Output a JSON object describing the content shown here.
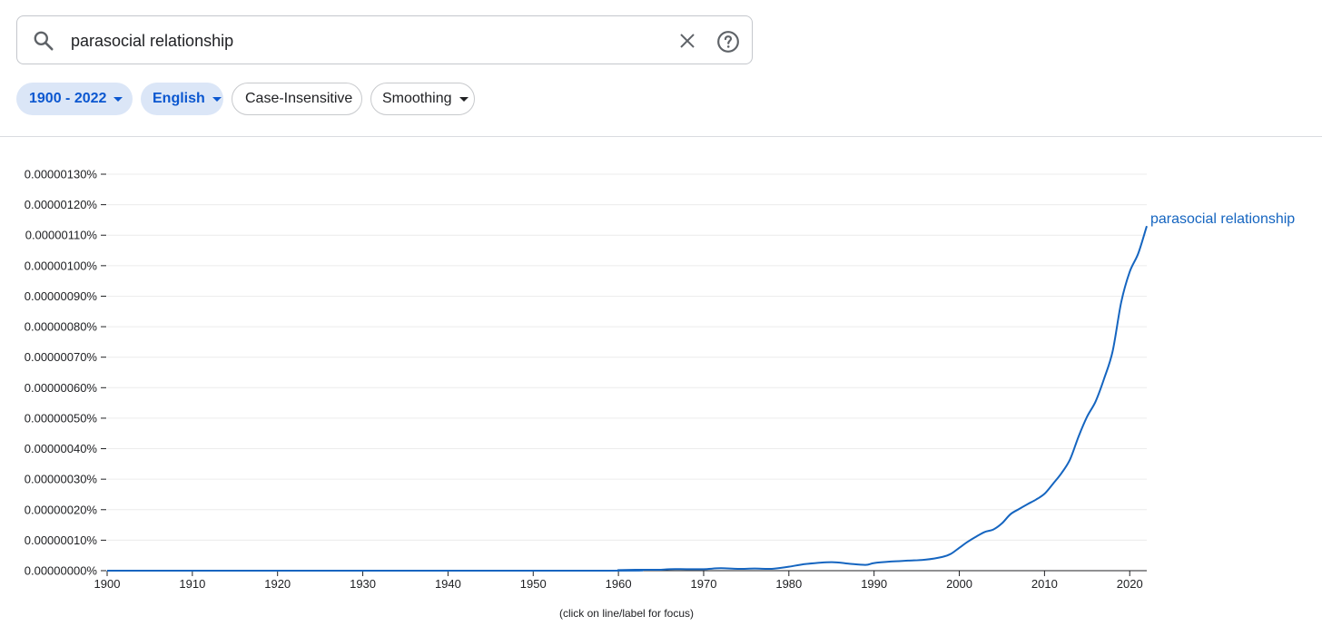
{
  "search": {
    "query": "parasocial relationship"
  },
  "filters": {
    "year_range": "1900 - 2022",
    "corpus": "English",
    "case": "Case-Insensitive",
    "smoothing": "Smoothing"
  },
  "chart_data": {
    "type": "line",
    "ylim": [
      0,
      1.3e-06
    ],
    "xlim": [
      1900,
      2022
    ],
    "y_ticks": [
      "0.00000000%",
      "0.00000010%",
      "0.00000020%",
      "0.00000030%",
      "0.00000040%",
      "0.00000050%",
      "0.00000060%",
      "0.00000070%",
      "0.00000080%",
      "0.00000090%",
      "0.00000100%",
      "0.00000110%",
      "0.00000120%",
      "0.00000130%"
    ],
    "x_ticks": [
      "1900",
      "1910",
      "1920",
      "1930",
      "1940",
      "1950",
      "1960",
      "1970",
      "1980",
      "1990",
      "2000",
      "2010",
      "2020"
    ],
    "grid": true,
    "series": [
      {
        "name": "parasocial relationship",
        "color": "#1565c0",
        "x": [
          1900,
          1958,
          1960,
          1962,
          1964,
          1965,
          1966,
          1968,
          1970,
          1972,
          1974,
          1976,
          1978,
          1980,
          1982,
          1985,
          1987,
          1989,
          1990,
          1992,
          1994,
          1996,
          1998,
          1999,
          2000,
          2001,
          2002,
          2003,
          2004,
          2005,
          2006,
          2007,
          2008,
          2009,
          2010,
          2011,
          2012,
          2013,
          2014,
          2015,
          2016,
          2017,
          2018,
          2019,
          2020,
          2021,
          2022
        ],
        "values": [
          0,
          0,
          2e-09,
          3e-09,
          3e-09,
          3e-09,
          5e-09,
          5e-09,
          5e-09,
          8e-09,
          6e-09,
          7e-09,
          6e-09,
          1.3e-08,
          2.2e-08,
          2.8e-08,
          2.3e-08,
          1.9e-08,
          2.5e-08,
          3e-08,
          3.3e-08,
          3.6e-08,
          4.5e-08,
          5.5e-08,
          7.5e-08,
          9.5e-08,
          1.12e-07,
          1.27e-07,
          1.35e-07,
          1.55e-07,
          1.85e-07,
          2.02e-07,
          2.18e-07,
          2.33e-07,
          2.52e-07,
          2.85e-07,
          3.2e-07,
          3.65e-07,
          4.4e-07,
          5.05e-07,
          5.55e-07,
          6.3e-07,
          7.2e-07,
          8.8e-07,
          9.8e-07,
          1.04e-06,
          1.13e-06
        ]
      }
    ],
    "note": "(click on line/label for focus)"
  }
}
